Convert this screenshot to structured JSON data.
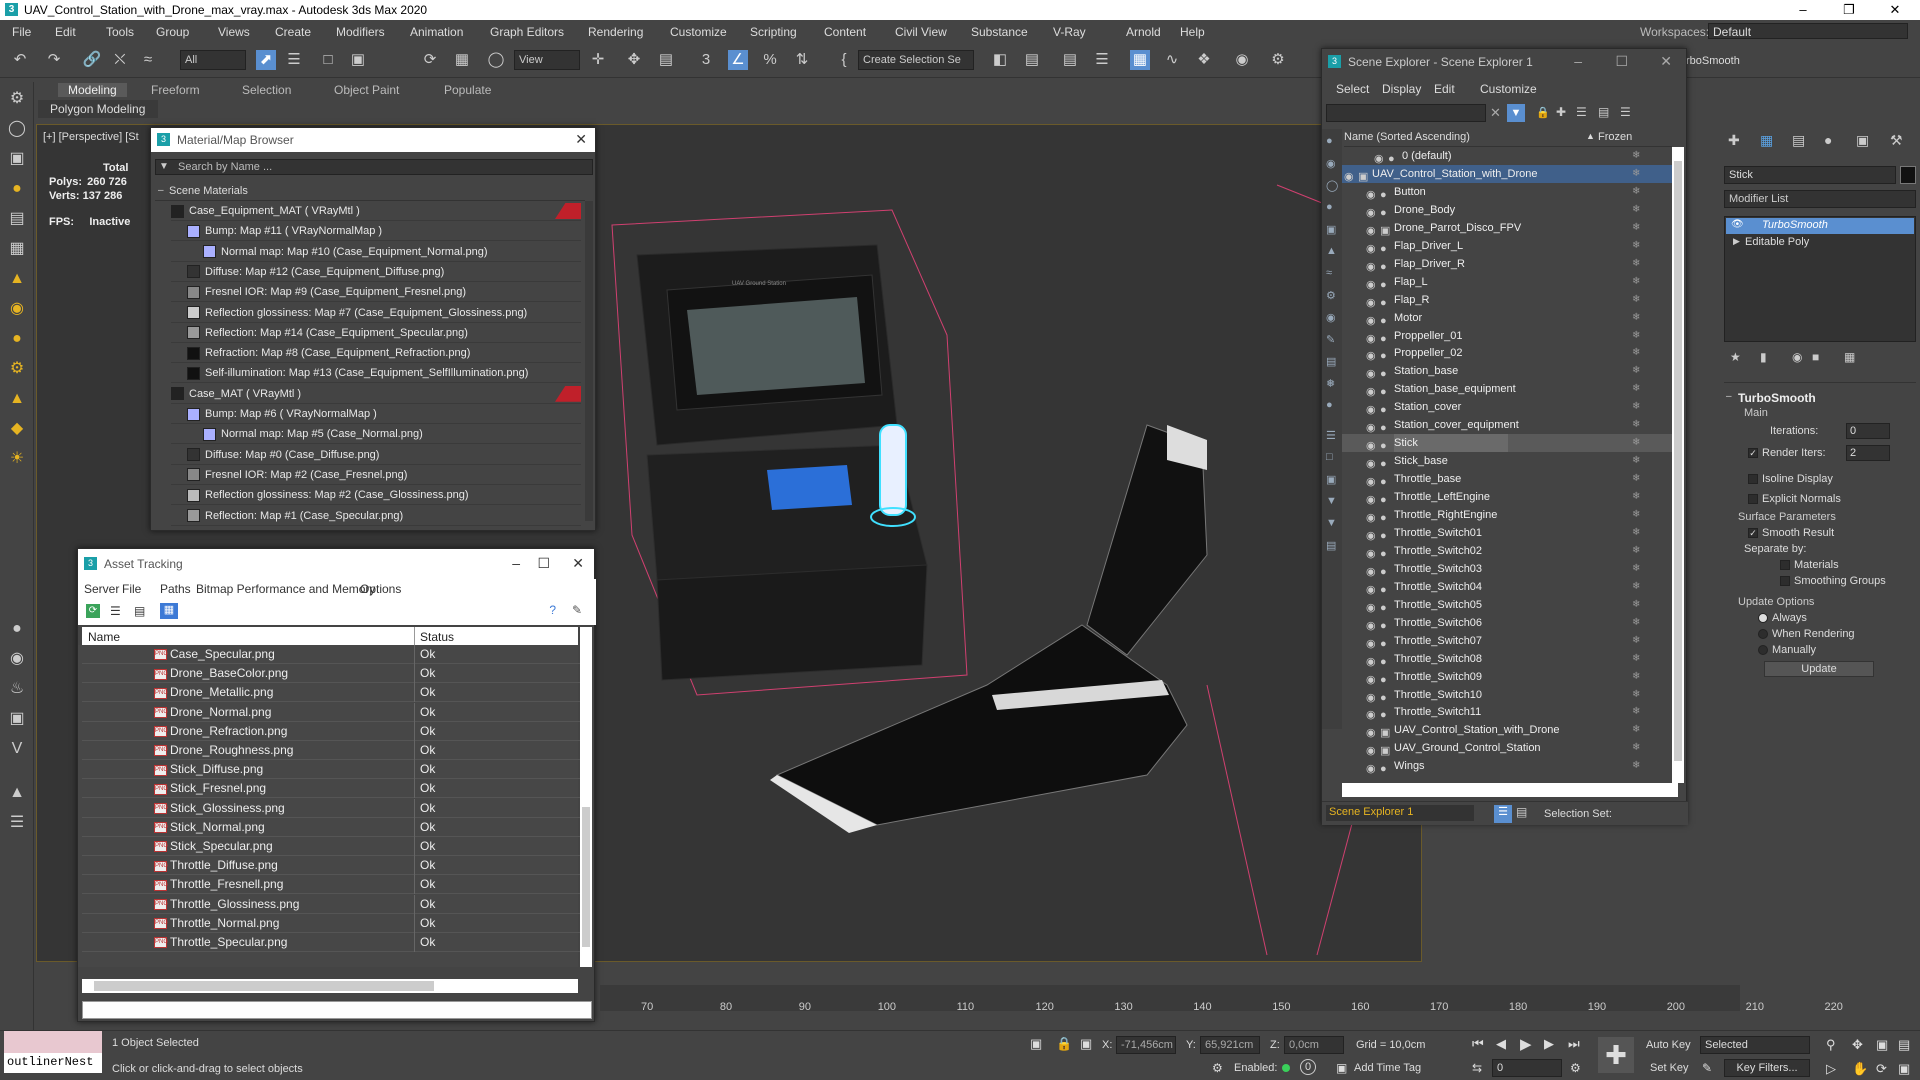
{
  "app": {
    "title": "UAV_Control_Station_with_Drone_max_vray.max - Autodesk 3ds Max 2020",
    "workspace_label": "Workspaces:",
    "workspace_value": "Default"
  },
  "menu": [
    "File",
    "Edit",
    "Tools",
    "Group",
    "Views",
    "Create",
    "Modifiers",
    "Animation",
    "Graph Editors",
    "Rendering",
    "Customize",
    "Scripting",
    "Content",
    "Civil View",
    "Substance",
    "V-Ray",
    "Arnold",
    "Help"
  ],
  "toolbar": {
    "filter_value": "All",
    "view_value": "View",
    "selection_set": "Create Selection Se",
    "turbosmooth_fragment": "rboSmooth"
  },
  "ribbon": {
    "tabs": [
      "Modeling",
      "Freeform",
      "Selection",
      "Object Paint",
      "Populate"
    ],
    "sub_label": "Polygon Modeling"
  },
  "viewport": {
    "label": "[+] [Perspective] [St",
    "stats": {
      "total_label": "Total",
      "polys_label": "Polys:",
      "polys_value": "260 726",
      "verts_label": "Verts:",
      "verts_value": "137 286",
      "fps_label": "FPS:",
      "fps_value": "Inactive"
    },
    "case_screen_text": "UAV Ground Station"
  },
  "material_browser": {
    "title": "Material/Map Browser",
    "search_placeholder": "Search by Name ...",
    "section": "Scene Materials",
    "rows": [
      {
        "indent": 0,
        "text": "Case_Equipment_MAT ( VRayMtl )",
        "swatch": "#222",
        "flag": true
      },
      {
        "indent": 1,
        "text": "Bump: Map #11 ( VRayNormalMap )",
        "swatch": "#aab0ff",
        "flag": false
      },
      {
        "indent": 2,
        "text": "Normal map: Map #10 (Case_Equipment_Normal.png)",
        "swatch": "#aab0ff",
        "flag": false
      },
      {
        "indent": 1,
        "text": "Diffuse: Map #12 (Case_Equipment_Diffuse.png)",
        "swatch": "#333",
        "flag": false
      },
      {
        "indent": 1,
        "text": "Fresnel IOR: Map #9 (Case_Equipment_Fresnel.png)",
        "swatch": "#888",
        "flag": false
      },
      {
        "indent": 1,
        "text": "Reflection glossiness: Map #7 (Case_Equipment_Glossiness.png)",
        "swatch": "#ccc",
        "flag": false
      },
      {
        "indent": 1,
        "text": "Reflection: Map #14 (Case_Equipment_Specular.png)",
        "swatch": "#999",
        "flag": false
      },
      {
        "indent": 1,
        "text": "Refraction: Map #8 (Case_Equipment_Refraction.png)",
        "swatch": "#111",
        "flag": false
      },
      {
        "indent": 1,
        "text": "Self-illumination: Map #13 (Case_Equipment_SelfIllumination.png)",
        "swatch": "#111",
        "flag": false
      },
      {
        "indent": 0,
        "text": "Case_MAT ( VRayMtl )",
        "swatch": "#222",
        "flag": true
      },
      {
        "indent": 1,
        "text": "Bump: Map #6 ( VRayNormalMap )",
        "swatch": "#aab0ff",
        "flag": false
      },
      {
        "indent": 2,
        "text": "Normal map: Map #5 (Case_Normal.png)",
        "swatch": "#aab0ff",
        "flag": false
      },
      {
        "indent": 1,
        "text": "Diffuse: Map #0 (Case_Diffuse.png)",
        "swatch": "#333",
        "flag": false
      },
      {
        "indent": 1,
        "text": "Fresnel IOR: Map #2 (Case_Fresnel.png)",
        "swatch": "#888",
        "flag": false
      },
      {
        "indent": 1,
        "text": "Reflection glossiness: Map #2 (Case_Glossiness.png)",
        "swatch": "#bbb",
        "flag": false
      },
      {
        "indent": 1,
        "text": "Reflection: Map #1 (Case_Specular.png)",
        "swatch": "#999",
        "flag": false
      }
    ]
  },
  "asset_tracking": {
    "title": "Asset Tracking",
    "menu": [
      "Server",
      "File",
      "Paths",
      "Bitmap Performance and Memory",
      "Options"
    ],
    "col_name": "Name",
    "col_status": "Status",
    "rows": [
      {
        "name": "Case_Specular.png",
        "status": "Ok"
      },
      {
        "name": "Drone_BaseColor.png",
        "status": "Ok"
      },
      {
        "name": "Drone_Metallic.png",
        "status": "Ok"
      },
      {
        "name": "Drone_Normal.png",
        "status": "Ok"
      },
      {
        "name": "Drone_Refraction.png",
        "status": "Ok"
      },
      {
        "name": "Drone_Roughness.png",
        "status": "Ok"
      },
      {
        "name": "Stick_Diffuse.png",
        "status": "Ok"
      },
      {
        "name": "Stick_Fresnel.png",
        "status": "Ok"
      },
      {
        "name": "Stick_Glossiness.png",
        "status": "Ok"
      },
      {
        "name": "Stick_Normal.png",
        "status": "Ok"
      },
      {
        "name": "Stick_Specular.png",
        "status": "Ok"
      },
      {
        "name": "Throttle_Diffuse.png",
        "status": "Ok"
      },
      {
        "name": "Throttle_Fresnell.png",
        "status": "Ok"
      },
      {
        "name": "Throttle_Glossiness.png",
        "status": "Ok"
      },
      {
        "name": "Throttle_Normal.png",
        "status": "Ok"
      },
      {
        "name": "Throttle_Specular.png",
        "status": "Ok"
      }
    ]
  },
  "scene_explorer": {
    "title": "Scene Explorer - Scene Explorer 1",
    "menu": [
      "Select",
      "Display",
      "Edit",
      "Customize"
    ],
    "col_name": "Name (Sorted Ascending)",
    "col_frozen": "Frozen",
    "layer_default": "0 (default)",
    "root": "UAV_Control_Station_with_Drone",
    "items": [
      "Button",
      "Drone_Body",
      "Drone_Parrot_Disco_FPV",
      "Flap_Driver_L",
      "Flap_Driver_R",
      "Flap_L",
      "Flap_R",
      "Motor",
      "Proppeller_01",
      "Proppeller_02",
      "Station_base",
      "Station_base_equipment",
      "Station_cover",
      "Station_cover_equipment",
      "Stick",
      "Stick_base",
      "Throttle_base",
      "Throttle_LeftEngine",
      "Throttle_RightEngine",
      "Throttle_Switch01",
      "Throttle_Switch02",
      "Throttle_Switch03",
      "Throttle_Switch04",
      "Throttle_Switch05",
      "Throttle_Switch06",
      "Throttle_Switch07",
      "Throttle_Switch08",
      "Throttle_Switch09",
      "Throttle_Switch10",
      "Throttle_Switch11",
      "UAV_Control_Station_with_Drone",
      "UAV_Ground_Control_Station",
      "Wings"
    ],
    "selected_item": "Stick",
    "footer_name": "Scene Explorer 1",
    "footer_selset": "Selection Set:"
  },
  "command_panel": {
    "object_name": "Stick",
    "modifier_list": "Modifier List",
    "stack": [
      "TurboSmooth",
      "Editable Poly"
    ],
    "turbosmooth": {
      "title": "TurboSmooth",
      "main": "Main",
      "iterations_label": "Iterations:",
      "iterations_value": "0",
      "render_iters_label": "Render Iters:",
      "render_iters_value": "2",
      "isoline": "Isoline Display",
      "explicit": "Explicit Normals",
      "surface_params": "Surface Parameters",
      "smooth_result": "Smooth Result",
      "separate_by": "Separate by:",
      "materials": "Materials",
      "smoothing_groups": "Smoothing Groups",
      "update_options": "Update Options",
      "always": "Always",
      "when_rendering": "When Rendering",
      "manually": "Manually",
      "update_button": "Update"
    }
  },
  "timeline": {
    "ticks": [
      "70",
      "80",
      "90",
      "100",
      "110",
      "120",
      "130",
      "140",
      "150",
      "160",
      "170",
      "180",
      "190",
      "200",
      "210",
      "220"
    ]
  },
  "status": {
    "script_value": "outlinerNest",
    "selected": "1 Object Selected",
    "prompt": "Click or click-and-drag to select objects",
    "x_label": "X:",
    "x_value": "-71,456cm",
    "y_label": "Y:",
    "y_value": "65,921cm",
    "z_label": "Z:",
    "z_value": "0,0cm",
    "grid": "Grid = 10,0cm",
    "enabled_label": "Enabled:",
    "add_time_tag": "Add Time Tag",
    "frame_value": "0",
    "auto_key": "Auto Key",
    "set_key": "Set Key",
    "key_mode": "Selected",
    "key_filters": "Key Filters..."
  }
}
